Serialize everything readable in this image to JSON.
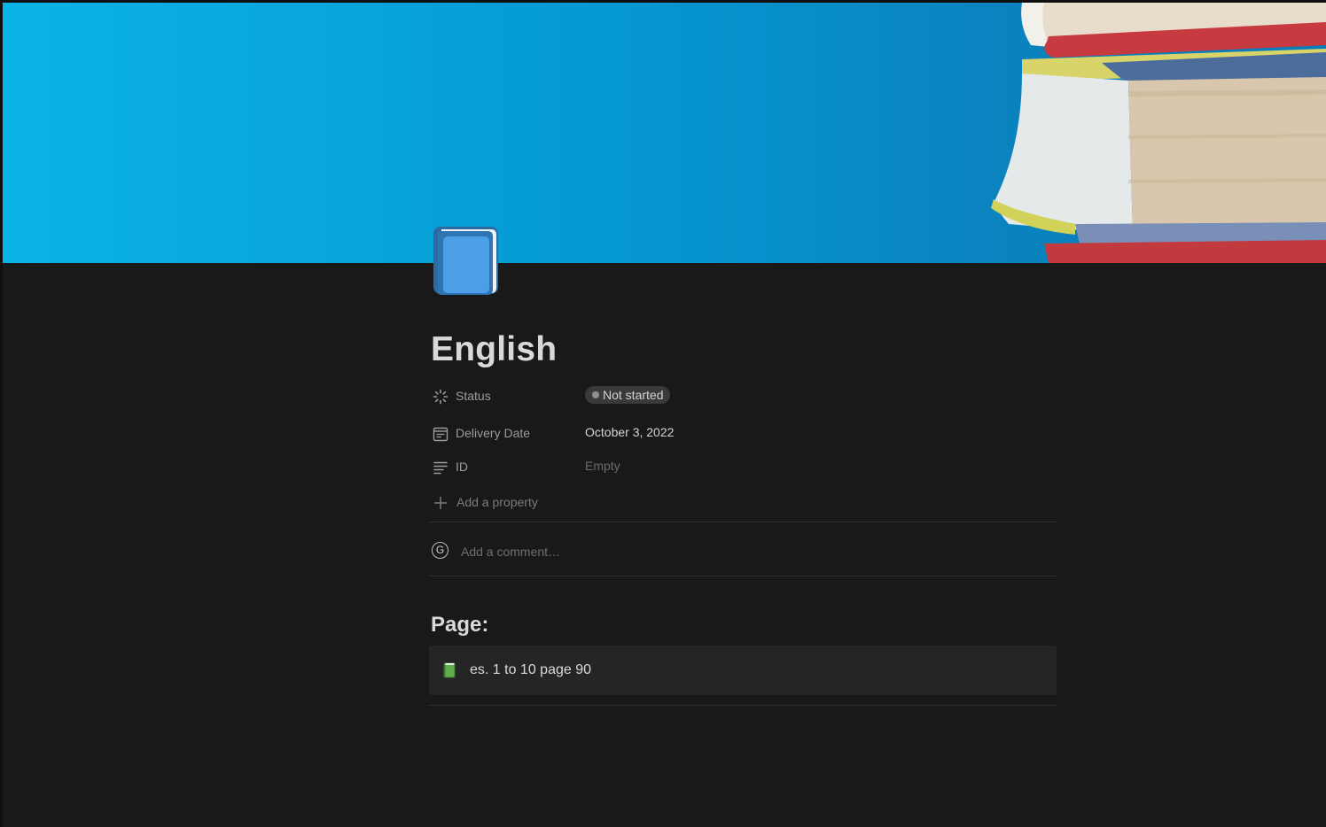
{
  "page": {
    "icon": "blue-book-icon",
    "title": "English"
  },
  "properties": [
    {
      "icon": "status-icon",
      "label": "Status",
      "value": "Not started",
      "type": "status",
      "status_color": "#8f8f8f"
    },
    {
      "icon": "calendar-icon",
      "label": "Delivery Date",
      "value": "October 3, 2022",
      "type": "date"
    },
    {
      "icon": "text-icon",
      "label": "ID",
      "value": "Empty",
      "type": "text"
    }
  ],
  "add_property": {
    "icon": "plus-icon",
    "label": "Add a property"
  },
  "comment": {
    "avatar_initial": "G",
    "placeholder": "Add a comment…"
  },
  "content": {
    "heading": "Page:",
    "callout": {
      "icon": "green-book-icon",
      "text": "es. 1 to 10 page 90"
    }
  },
  "colors": {
    "background": "#191919",
    "cover_blue": "#0599d3",
    "book_blue": "#4a9fe6",
    "book_green": "#5fae4c"
  }
}
